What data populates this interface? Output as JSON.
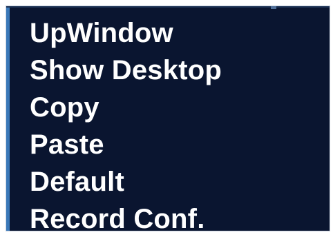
{
  "menu": {
    "items": [
      {
        "label": "UpWindow"
      },
      {
        "label": "Show Desktop"
      },
      {
        "label": "Copy"
      },
      {
        "label": "Paste"
      },
      {
        "label": "Default"
      },
      {
        "label": "Record Conf."
      }
    ]
  },
  "colors": {
    "background": "#0a1530",
    "text": "#ffffff",
    "accent": "#3a78b8"
  }
}
